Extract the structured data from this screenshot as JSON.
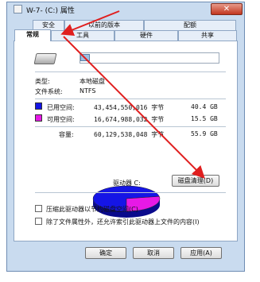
{
  "window": {
    "title": "W-7-  (C:) 属性",
    "close_glyph": "✕"
  },
  "tabs_row_back": [
    "安全",
    "以前的版本",
    "配额"
  ],
  "tabs_row_front": [
    "常规",
    "工具",
    "硬件",
    "共享"
  ],
  "general": {
    "type_label": "类型:",
    "type_value": "本地磁盘",
    "fs_label": "文件系统:",
    "fs_value": "NTFS",
    "used_label": "已用空间:",
    "used_bytes": "43,454,550,016 字节",
    "used_size": "40.4 GB",
    "free_label": "可用空间:",
    "free_bytes": "16,674,988,032 字节",
    "free_size": "15.5 GB",
    "capacity_label": "容量:",
    "capacity_bytes": "60,129,538,048 字节",
    "capacity_size": "55.9 GB",
    "drive_label": "驱动器 C:",
    "cleanup_button": "磁盘清理(D)",
    "compress_check": "压缩此驱动器以节约磁盘空间(C)",
    "index_check": "除了文件属性外，还允许索引此驱动器上文件的内容(I)"
  },
  "buttons": {
    "ok": "确定",
    "cancel": "取消",
    "apply": "应用(A)"
  },
  "colors": {
    "used": "#1515e6",
    "free": "#e619e6",
    "arrow": "#e01f1f",
    "dialog_bg": "#c9dbef"
  },
  "icons": {
    "drive": "hard-drive-icon",
    "close": "close-icon",
    "window": "window-icon"
  },
  "chart_data": {
    "type": "pie",
    "categories": [
      "已用空间",
      "可用空间"
    ],
    "values": [
      43454550016,
      16674988032
    ]
  }
}
